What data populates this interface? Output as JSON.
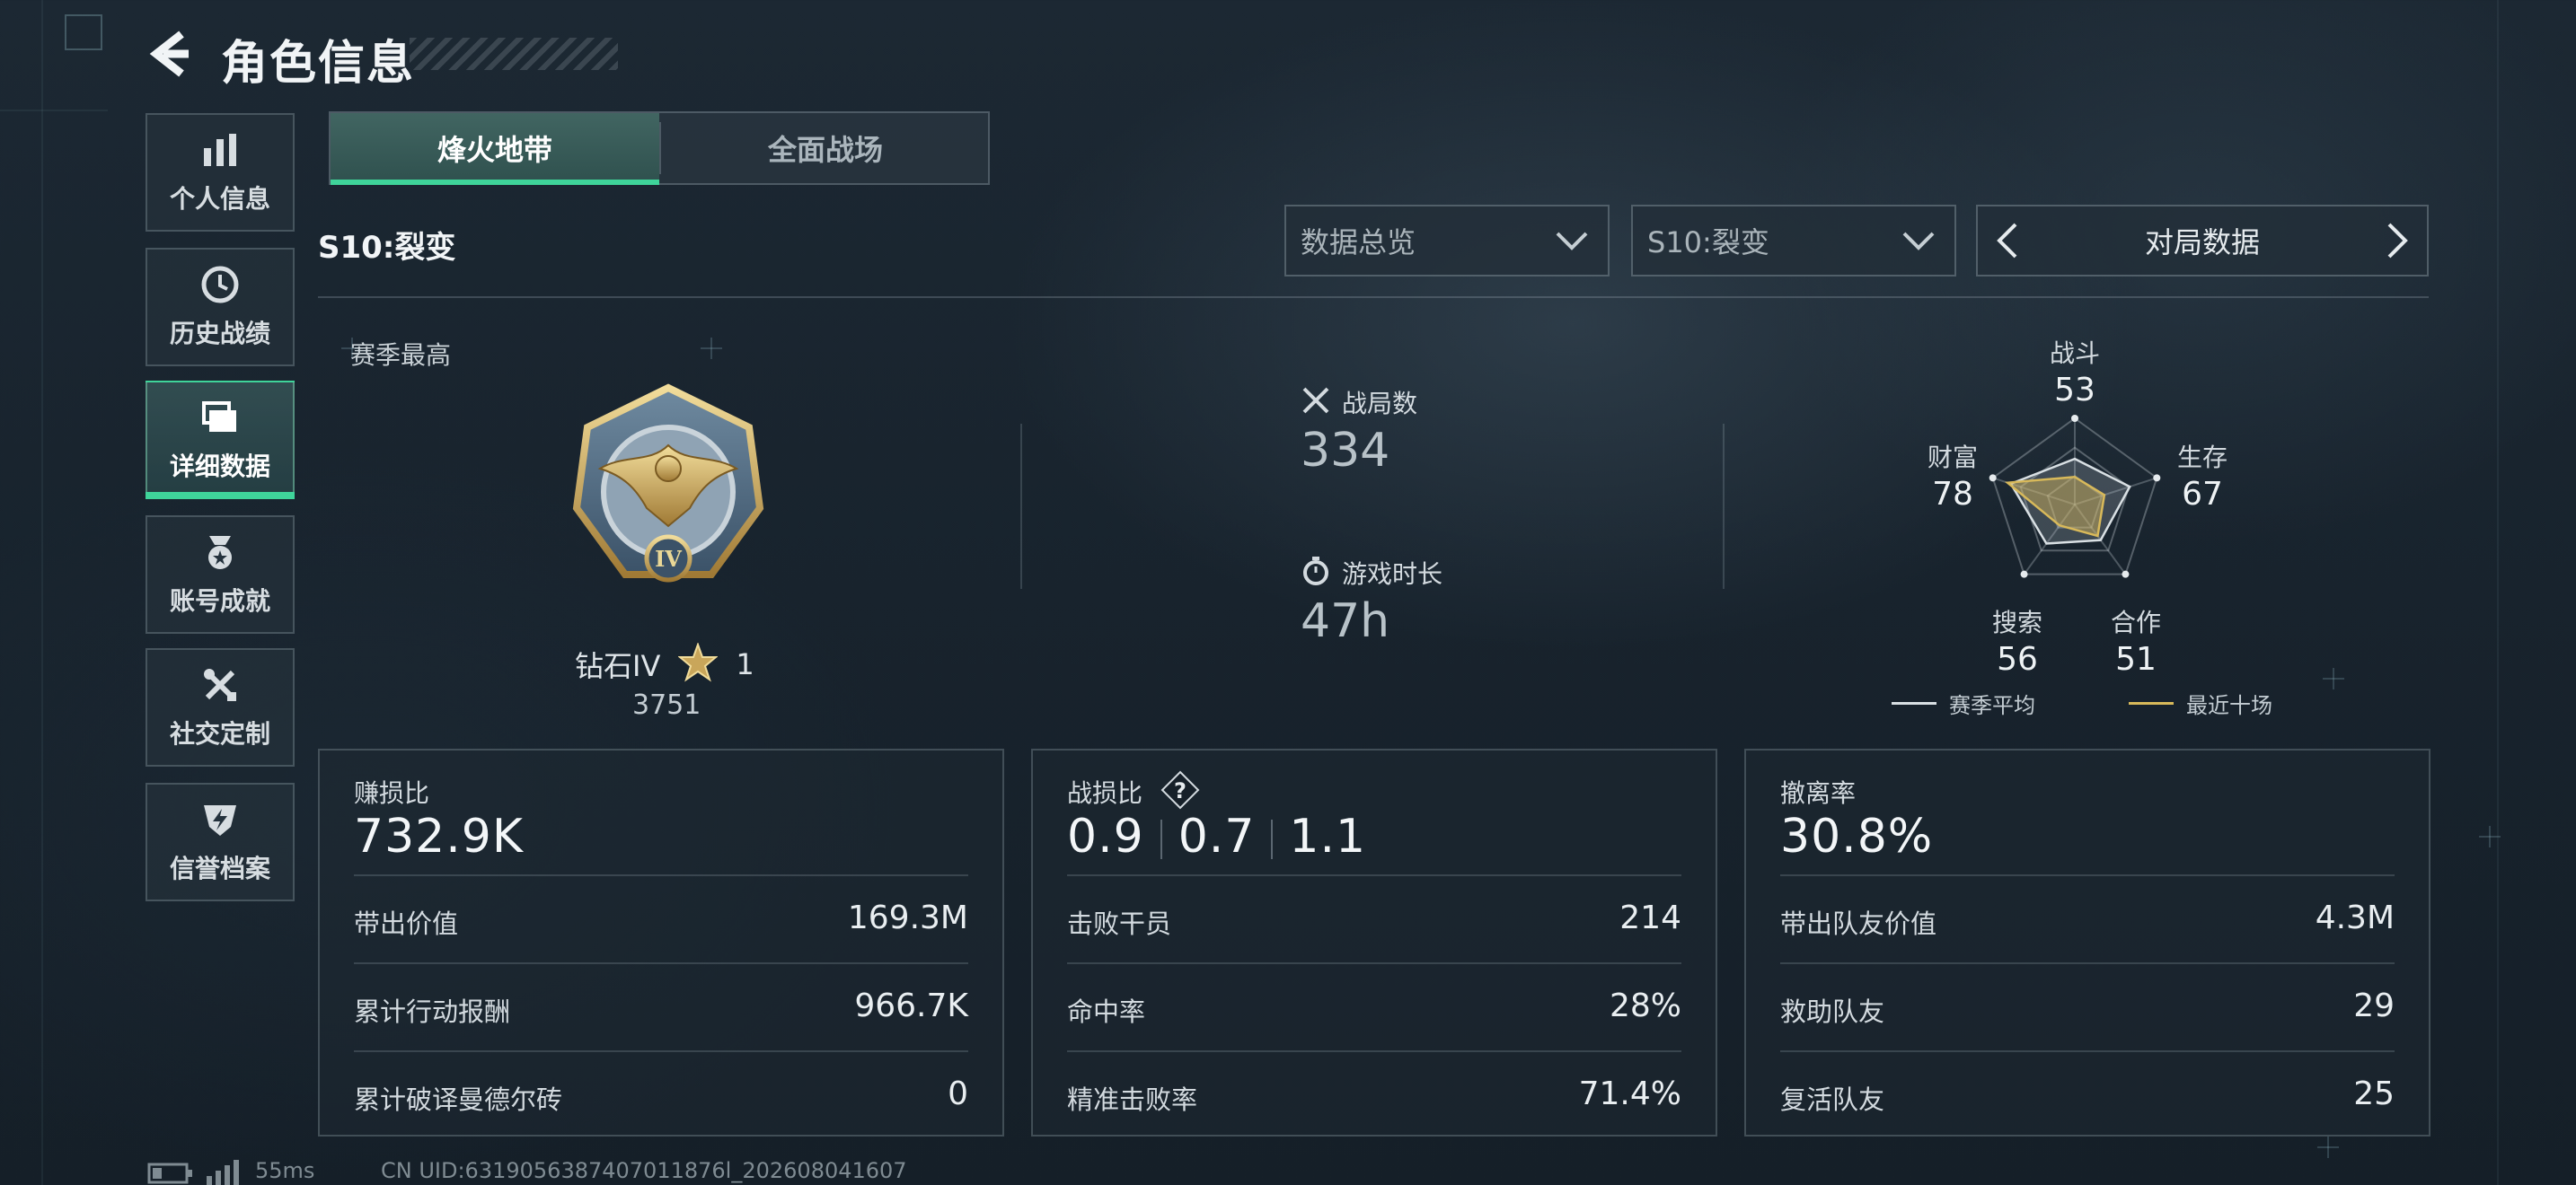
{
  "header": {
    "title": "角色信息"
  },
  "sidebar": {
    "items": [
      {
        "label": "个人信息",
        "icon": "bar-chart-icon"
      },
      {
        "label": "历史战绩",
        "icon": "clock-icon"
      },
      {
        "label": "详细数据",
        "icon": "folders-icon",
        "active": true
      },
      {
        "label": "账号成就",
        "icon": "medal-icon"
      },
      {
        "label": "社交定制",
        "icon": "tools-icon"
      },
      {
        "label": "信誉档案",
        "icon": "badge-icon"
      }
    ]
  },
  "mode_tabs": [
    {
      "label": "烽火地带",
      "active": true
    },
    {
      "label": "全面战场",
      "active": false
    }
  ],
  "season_label": "S10:裂变",
  "filters": {
    "data_select": "数据总览",
    "season_select": "S10:裂变",
    "stat_nav": "对局数据"
  },
  "rank": {
    "caption": "赛季最高",
    "name": "钻石IV",
    "stars": "1",
    "score": "3751",
    "emblem_numeral": "IV"
  },
  "summary": {
    "matches_label": "战局数",
    "matches_value": "334",
    "playtime_label": "游戏时长",
    "playtime_value": "47h"
  },
  "radar": {
    "axes": [
      {
        "label": "战斗",
        "value": "53"
      },
      {
        "label": "生存",
        "value": "67"
      },
      {
        "label": "合作",
        "value": "51"
      },
      {
        "label": "搜索",
        "value": "56"
      },
      {
        "label": "财富",
        "value": "78"
      }
    ],
    "recent_ratios": [
      0.32,
      0.36,
      0.45,
      0.3,
      0.82
    ],
    "legend": {
      "season_avg": "赛季平均",
      "recent_ten": "最近十场"
    },
    "colors": {
      "season_avg": "#d9e0e4",
      "recent_ten": "#d8b95a"
    }
  },
  "cards": {
    "profit": {
      "title": "赚损比",
      "value": "732.9K",
      "rows": [
        {
          "label": "带出价值",
          "value": "169.3M"
        },
        {
          "label": "累计行动报酬",
          "value": "966.7K"
        },
        {
          "label": "累计破译曼德尔砖",
          "value": "0"
        }
      ]
    },
    "combat": {
      "title": "战损比",
      "ratios": [
        "0.9",
        "0.7",
        "1.1"
      ],
      "rows": [
        {
          "label": "击败干员",
          "value": "214"
        },
        {
          "label": "命中率",
          "value": "28%"
        },
        {
          "label": "精准击败率",
          "value": "71.4%"
        }
      ]
    },
    "extract": {
      "title": "撤离率",
      "value": "30.8%",
      "rows": [
        {
          "label": "带出队友价值",
          "value": "4.3M"
        },
        {
          "label": "救助队友",
          "value": "29"
        },
        {
          "label": "复活队友",
          "value": "25"
        }
      ]
    }
  },
  "footer": {
    "ping": "55ms",
    "uid": "CN UID:6319056387407011876l_202608041607"
  },
  "colors": {
    "accent": "#3fd49a"
  }
}
